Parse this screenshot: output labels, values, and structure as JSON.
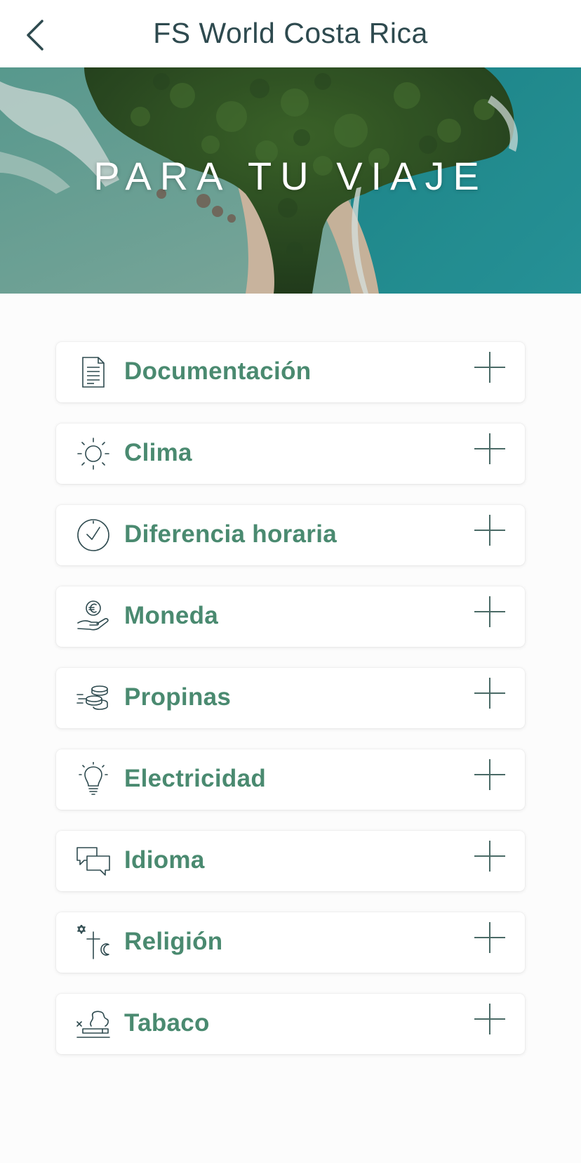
{
  "header": {
    "title": "FS World Costa Rica",
    "back_icon": "chevron-left-icon"
  },
  "hero": {
    "title": "PARA TU VIAJE"
  },
  "colors": {
    "label": "#4a8a70",
    "icon": "#2e4a4f",
    "title": "#2e4a4f"
  },
  "sections": [
    {
      "label": "Documentación",
      "icon": "document-icon"
    },
    {
      "label": "Clima",
      "icon": "sun-icon"
    },
    {
      "label": "Diferencia horaria",
      "icon": "clock-icon"
    },
    {
      "label": "Moneda",
      "icon": "euro-hand-icon"
    },
    {
      "label": "Propinas",
      "icon": "coins-icon"
    },
    {
      "label": "Electricidad",
      "icon": "lightbulb-icon"
    },
    {
      "label": "Idioma",
      "icon": "chat-bubbles-icon"
    },
    {
      "label": "Religión",
      "icon": "religion-symbols-icon"
    },
    {
      "label": "Tabaco",
      "icon": "cigarette-icon"
    }
  ]
}
